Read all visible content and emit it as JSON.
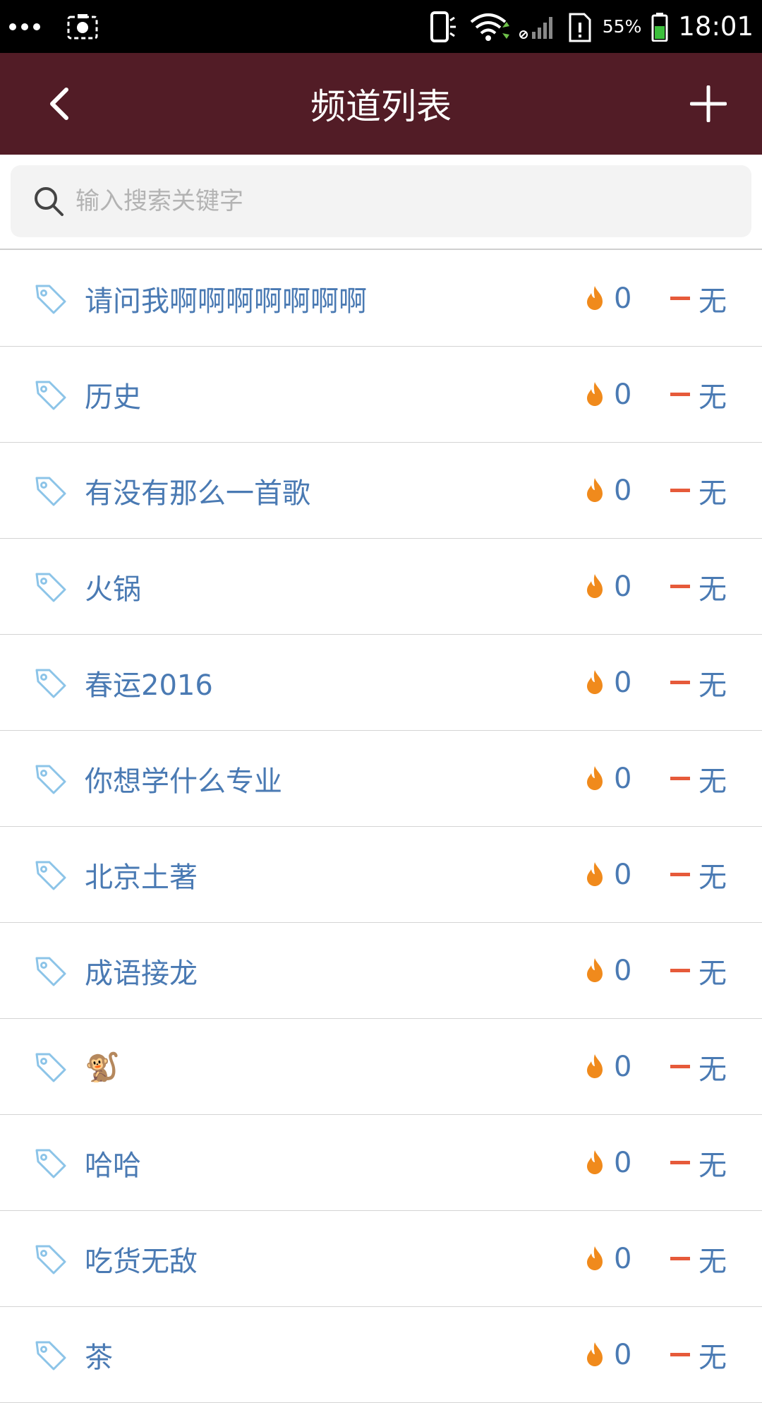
{
  "status_bar": {
    "battery_percent": "55%",
    "time": "18:01",
    "icons": [
      "more-dots-icon",
      "screenshot-icon",
      "phone-vibrate-icon",
      "wifi-icon",
      "cellular-signal-icon",
      "sim-alert-icon",
      "battery-icon"
    ]
  },
  "header": {
    "title": "频道列表",
    "back_icon": "chevron-left-icon",
    "add_icon": "plus-icon",
    "background": "#521c26"
  },
  "search": {
    "placeholder": "输入搜索关键字",
    "value": ""
  },
  "channels": [
    {
      "name": "请问我啊啊啊啊啊啊啊",
      "count": "0",
      "status": "无"
    },
    {
      "name": "历史",
      "count": "0",
      "status": "无"
    },
    {
      "name": "有没有那么一首歌",
      "count": "0",
      "status": "无"
    },
    {
      "name": "火锅",
      "count": "0",
      "status": "无"
    },
    {
      "name": "春运2016",
      "count": "0",
      "status": "无"
    },
    {
      "name": "你想学什么专业",
      "count": "0",
      "status": "无"
    },
    {
      "name": "北京土著",
      "count": "0",
      "status": "无"
    },
    {
      "name": "成语接龙",
      "count": "0",
      "status": "无"
    },
    {
      "name": "🐒",
      "count": "0",
      "status": "无"
    },
    {
      "name": "哈哈",
      "count": "0",
      "status": "无"
    },
    {
      "name": "吃货无敌",
      "count": "0",
      "status": "无"
    },
    {
      "name": "茶",
      "count": "0",
      "status": "无"
    }
  ],
  "colors": {
    "text_blue": "#4a7ab3",
    "fire_orange": "#f08a1c",
    "dash_red": "#e65a3a",
    "tag_blue": "#8cc4e8"
  }
}
